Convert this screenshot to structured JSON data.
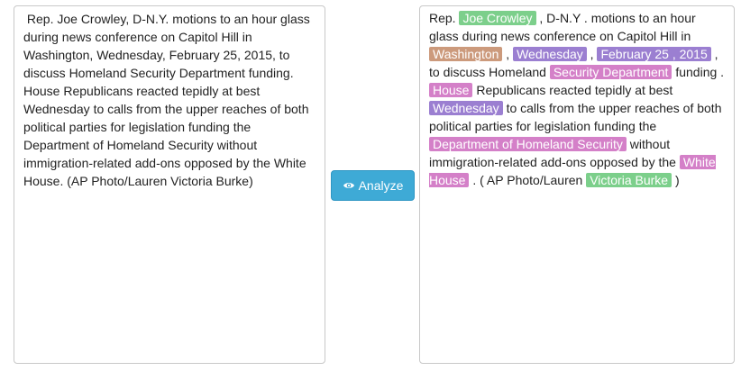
{
  "input": {
    "value": " Rep. Joe Crowley, D-N.Y. motions to an hour glass during news conference on Capitol Hill in Washington, Wednesday, February 25, 2015, to discuss Homeland Security Department funding. House Republicans reacted tepidly at best Wednesday to calls from the upper reaches of both political parties for legislation funding the Department of Homeland Security without immigration-related add-ons opposed by the White House. (AP Photo/Lauren Victoria Burke)"
  },
  "analyze_button": {
    "label": "Analyze",
    "icon": "eye-icon"
  },
  "output": {
    "segments": [
      {
        "text": "Rep. "
      },
      {
        "text": "Joe Crowley",
        "type": "person"
      },
      {
        "text": " , D-N.Y . motions to an hour glass during news conference on Capitol Hill in "
      },
      {
        "text": "Washington",
        "type": "location"
      },
      {
        "text": " , "
      },
      {
        "text": "Wednesday",
        "type": "date"
      },
      {
        "text": " , "
      },
      {
        "text": "February 25 , 2015",
        "type": "date"
      },
      {
        "text": " , to discuss Homeland "
      },
      {
        "text": "Security Department",
        "type": "org"
      },
      {
        "text": " funding . "
      },
      {
        "text": "House",
        "type": "org"
      },
      {
        "text": " Republicans reacted tepidly at best "
      },
      {
        "text": "Wednesday",
        "type": "date"
      },
      {
        "text": " to calls from the upper reaches of both political parties for legislation funding the "
      },
      {
        "text": "Department of Homeland Security",
        "type": "org"
      },
      {
        "text": " without immigration-related add-ons opposed by the "
      },
      {
        "text": "White House",
        "type": "org"
      },
      {
        "text": " . ( AP Photo/Lauren "
      },
      {
        "text": "Victoria Burke",
        "type": "person"
      },
      {
        "text": " )"
      }
    ]
  },
  "entity_colors": {
    "person": "#7ccf8b",
    "location": "#cc9a7c",
    "date": "#9b7fd1",
    "org": "#d480c8"
  }
}
